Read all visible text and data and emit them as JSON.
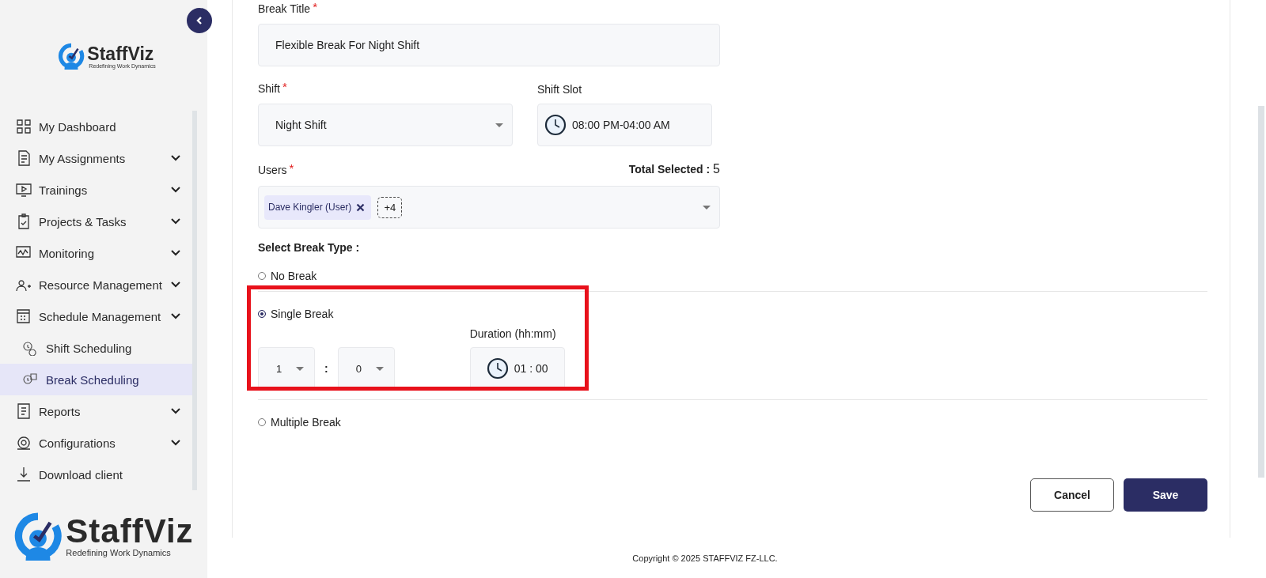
{
  "sidebar": {
    "logo_top": {
      "name": "StaffViz",
      "tagline": "Redefining Work Dynamics"
    },
    "items": [
      {
        "label": "My Dashboard",
        "expandable": false,
        "selected": false
      },
      {
        "label": "My Assignments",
        "expandable": true,
        "selected": false
      },
      {
        "label": "Trainings",
        "expandable": true,
        "selected": false
      },
      {
        "label": "Projects & Tasks",
        "expandable": true,
        "selected": false
      },
      {
        "label": "Monitoring",
        "expandable": true,
        "selected": false
      },
      {
        "label": "Resource Management",
        "expandable": true,
        "selected": false
      },
      {
        "label": "Schedule Management",
        "expandable": true,
        "selected": false,
        "children": [
          {
            "label": "Shift Scheduling",
            "selected": false
          },
          {
            "label": "Break Scheduling",
            "selected": true
          }
        ]
      },
      {
        "label": "Reports",
        "expandable": true,
        "selected": false
      },
      {
        "label": "Configurations",
        "expandable": true,
        "selected": false
      },
      {
        "label": "Download client",
        "expandable": false,
        "selected": false
      }
    ],
    "logo_bottom": {
      "name": "StaffViz",
      "tagline": "Redefining Work Dynamics"
    }
  },
  "form": {
    "break_title": {
      "label": "Break Title",
      "required_mark": "*",
      "value": "Flexible Break For Night Shift"
    },
    "shift": {
      "label": "Shift",
      "required_mark": "*",
      "value": "Night Shift"
    },
    "shift_slot": {
      "label": "Shift Slot",
      "value": "08:00 PM-04:00 AM"
    },
    "users": {
      "label": "Users",
      "required_mark": "*",
      "total_label": "Total Selected :",
      "total_value": "5",
      "chips": [
        "Dave Kingler (User)"
      ],
      "more": "+4"
    },
    "break_type": {
      "label": "Select Break Type :",
      "options": [
        {
          "label": "No Break",
          "selected": false
        },
        {
          "label": "Single Break",
          "selected": true,
          "hours": "1",
          "separator": ":",
          "minutes": "0",
          "duration_label": "Duration (hh:mm)",
          "duration": "01 : 00"
        },
        {
          "label": "Multiple Break",
          "selected": false
        }
      ]
    },
    "buttons": {
      "cancel": "Cancel",
      "save": "Save"
    }
  },
  "footer": "Copyright © 2025 STAFFVIZ FZ-LLC."
}
